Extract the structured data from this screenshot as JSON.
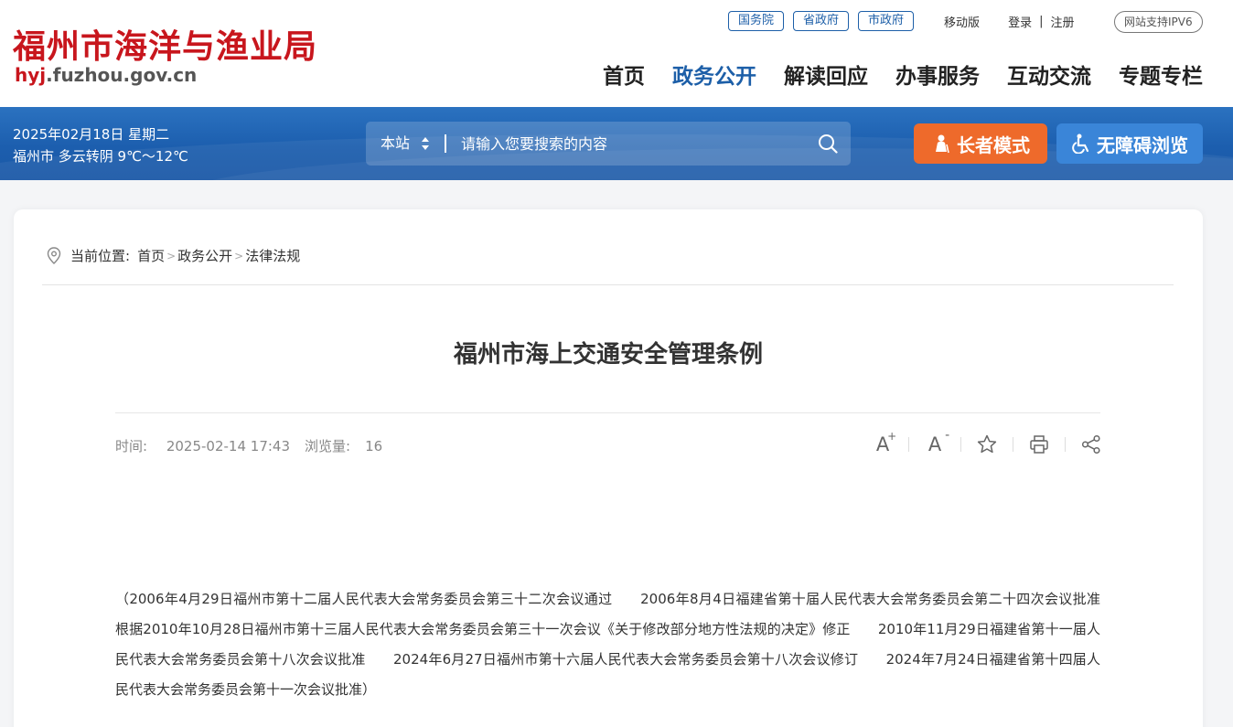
{
  "header": {
    "logo_cn": "福州市海洋与渔业局",
    "logo_url_highlight": "hyj",
    "logo_url_rest": ".fuzhou.gov.cn",
    "gov_links": [
      "国务院",
      "省政府",
      "市政府"
    ],
    "mobile": "移动版",
    "login": "登录",
    "separator": "|",
    "register": "注册",
    "ipv6": "网站支持IPV6",
    "nav": [
      "首页",
      "政务公开",
      "解读回应",
      "办事服务",
      "互动交流",
      "专题专栏"
    ],
    "active_nav": "政务公开"
  },
  "bar": {
    "date": "2025年02月18日 星期二",
    "weather": "福州市 多云转阴 9℃～12℃",
    "search_scope": "本站",
    "search_placeholder": "请输入您要搜索的内容",
    "elder_mode": "长者模式",
    "accessible": "无障碍浏览"
  },
  "breadcrumb": {
    "prefix": "当前位置:",
    "items": [
      "首页",
      "政务公开",
      "法律法规"
    ],
    "sep": ">"
  },
  "article": {
    "title": "福州市海上交通安全管理条例",
    "time_label": "时间:",
    "time_value": "2025-02-14 17:43",
    "views_label": "浏览量:",
    "views_value": "16",
    "tools": {
      "font_up": "A",
      "font_down": "A"
    },
    "body": "（2006年4月29日福州市第十二届人民代表大会常务委员会第三十二次会议通过　　2006年8月4日福建省第十届人民代表大会常务委员会第二十四次会议批准　　根据2010年10月28日福州市第十三届人民代表大会常务委员会第三十一次会议《关于修改部分地方性法规的决定》修正　　2010年11月29日福建省第十一届人民代表大会常务委员会第十八次会议批准　　2024年6月27日福州市第十六届人民代表大会常务委员会第十八次会议修订　　2024年7月24日福建省第十四届人民代表大会常务委员会第十一次会议批准）"
  },
  "colors": {
    "brand_red": "#c8161d",
    "brand_blue": "#1d5fa8",
    "elder_orange": "#ee6a2b",
    "access_blue": "#3a85d8"
  }
}
